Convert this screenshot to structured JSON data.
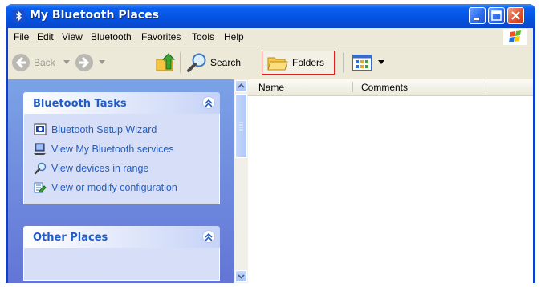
{
  "window": {
    "title": "My Bluetooth Places",
    "controls": [
      "minimize",
      "maximize",
      "close"
    ]
  },
  "menubar": {
    "items": [
      "File",
      "Edit",
      "View",
      "Bluetooth",
      "Favorites",
      "Tools",
      "Help"
    ]
  },
  "toolbar": {
    "back_label": "Back",
    "search_label": "Search",
    "folders_label": "Folders",
    "views_icon": "views-icon"
  },
  "taskpane": {
    "bluetooth_tasks": {
      "title": "Bluetooth Tasks",
      "items": [
        {
          "label": "Bluetooth Setup Wizard",
          "icon": "wizard-icon"
        },
        {
          "label": "View My Bluetooth services",
          "icon": "computer-icon"
        },
        {
          "label": "View devices in range",
          "icon": "search-icon"
        },
        {
          "label": "View or modify configuration",
          "icon": "configuration-icon"
        }
      ]
    },
    "other_places": {
      "title": "Other Places"
    }
  },
  "list": {
    "columns": [
      "Name",
      "Comments"
    ]
  },
  "colors": {
    "titlebar": "#0453e2",
    "taskpane": "#7ba2e7",
    "task_link": "#215dc6",
    "chrome": "#ece9d8",
    "highlight_border": "#e02020"
  }
}
